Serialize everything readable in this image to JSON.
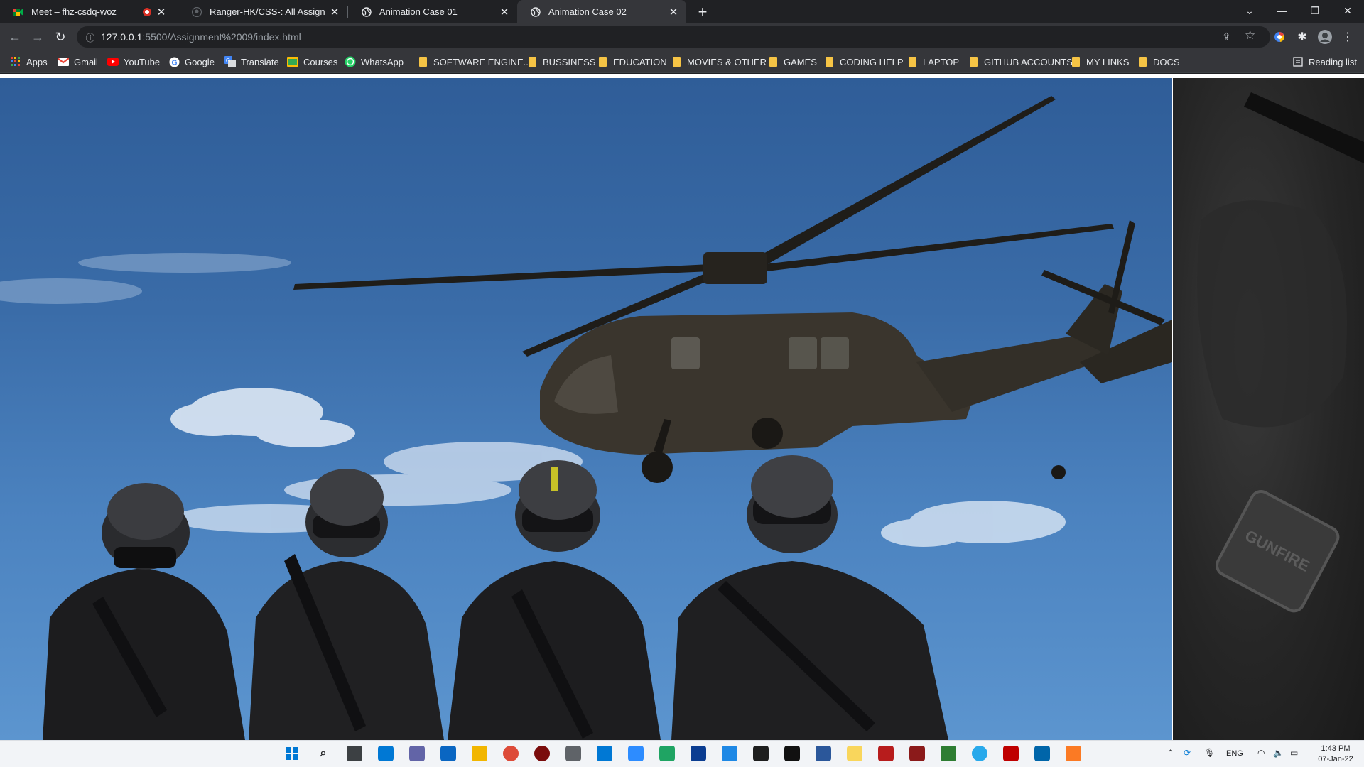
{
  "tabs": [
    {
      "title": "Meet – fhz-csdq-woz",
      "favicon": "google-meet-icon",
      "recording": true,
      "active": false
    },
    {
      "title": "Ranger-HK/CSS-: All Assignments",
      "favicon": "github-icon",
      "active": false
    },
    {
      "title": "Animation Case 01",
      "favicon": "globe-icon",
      "active": false
    },
    {
      "title": "Animation Case 02",
      "favicon": "globe-icon",
      "active": true
    }
  ],
  "window_controls": [
    "tab-search-icon",
    "minimize-icon",
    "restore-icon",
    "close-icon"
  ],
  "toolbar": {
    "url_host": "127.0.0.1",
    "url_rest": ":5500/Assignment%2009/index.html"
  },
  "bookmarks": [
    {
      "label": "Apps",
      "icon": "apps-grid-icon"
    },
    {
      "label": "Gmail",
      "icon": "gmail-icon"
    },
    {
      "label": "YouTube",
      "icon": "youtube-icon"
    },
    {
      "label": "Google",
      "icon": "google-icon"
    },
    {
      "label": "Translate",
      "icon": "translate-icon"
    },
    {
      "label": "Courses",
      "icon": "courses-icon"
    },
    {
      "label": "WhatsApp",
      "icon": "whatsapp-icon"
    },
    {
      "label": "SOFTWARE ENGINE...",
      "icon": "folder-icon"
    },
    {
      "label": "BUSSINESS",
      "icon": "folder-icon"
    },
    {
      "label": "EDUCATION",
      "icon": "folder-icon"
    },
    {
      "label": "MOVIES & OTHER",
      "icon": "folder-icon"
    },
    {
      "label": "GAMES",
      "icon": "folder-icon"
    },
    {
      "label": "CODING HELP",
      "icon": "folder-icon"
    },
    {
      "label": "LAPTOP",
      "icon": "folder-icon"
    },
    {
      "label": "GITHUB ACCOUNTS",
      "icon": "folder-icon"
    },
    {
      "label": "MY LINKS",
      "icon": "folder-icon"
    },
    {
      "label": "DOCS",
      "icon": "folder-icon"
    }
  ],
  "reading_list": "Reading list",
  "page": {
    "side_patch_text": "GUNFIRE"
  },
  "taskbar": {
    "language": "ENG",
    "time": "1:43 PM",
    "date": "07-Jan-22"
  }
}
